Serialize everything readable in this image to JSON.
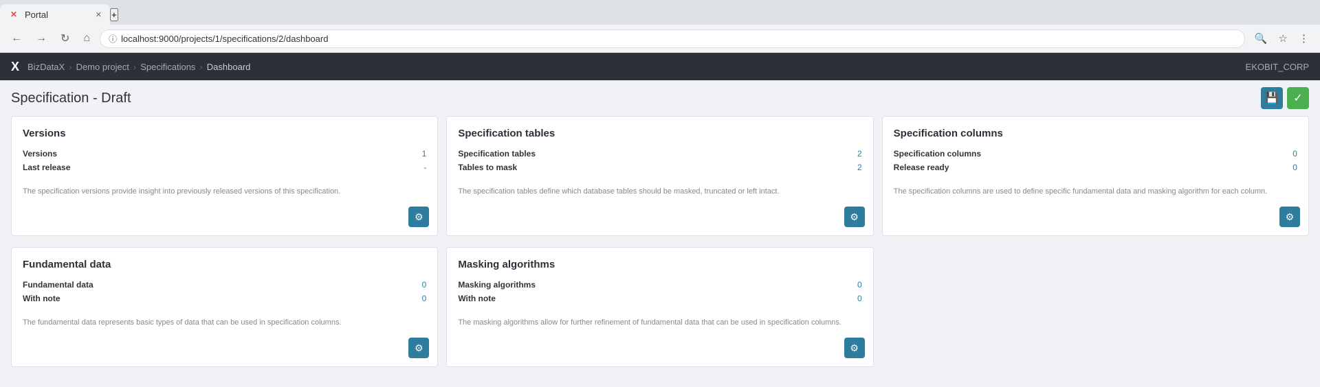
{
  "browser": {
    "tab_title": "Portal",
    "url": "localhost:9000/projects/1/specifications/2/dashboard",
    "new_tab_label": "+"
  },
  "app_nav": {
    "logo": "X",
    "breadcrumbs": [
      {
        "label": "BizDataX",
        "href": "#"
      },
      {
        "label": "Demo project",
        "href": "#"
      },
      {
        "label": "Specifications",
        "href": "#"
      },
      {
        "label": "Dashboard",
        "href": "#",
        "current": true
      }
    ],
    "user": "EKOBIT_CORP"
  },
  "page": {
    "title": "Specification - Draft",
    "actions": {
      "save_icon": "💾",
      "check_icon": "✓"
    }
  },
  "cards": [
    {
      "id": "versions",
      "title": "Versions",
      "stats": [
        {
          "label": "Versions",
          "value": "1"
        },
        {
          "label": "Last release",
          "value": "-"
        }
      ],
      "description": "The specification versions provide insight into previously released versions of this specification."
    },
    {
      "id": "specification-tables",
      "title": "Specification tables",
      "stats": [
        {
          "label": "Specification tables",
          "value": "2"
        },
        {
          "label": "Tables to mask",
          "value": "2"
        }
      ],
      "description": "The specification tables define which database tables should be masked, truncated or left intact."
    },
    {
      "id": "specification-columns",
      "title": "Specification columns",
      "stats": [
        {
          "label": "Specification columns",
          "value": "0"
        },
        {
          "label": "Release ready",
          "value": "0"
        }
      ],
      "description": "The specification columns are used to define specific fundamental data and masking algorithm for each column."
    },
    {
      "id": "fundamental-data",
      "title": "Fundamental data",
      "stats": [
        {
          "label": "Fundamental data",
          "value": "0"
        },
        {
          "label": "With note",
          "value": "0"
        }
      ],
      "description": "The fundamental data represents basic types of data that can be used in specification columns."
    },
    {
      "id": "masking-algorithms",
      "title": "Masking algorithms",
      "stats": [
        {
          "label": "Masking algorithms",
          "value": "0"
        },
        {
          "label": "With note",
          "value": "0"
        }
      ],
      "description": "The masking algorithms allow for further refinement of fundamental data that can be used in specification columns."
    }
  ],
  "gear_button_label": "⚙"
}
